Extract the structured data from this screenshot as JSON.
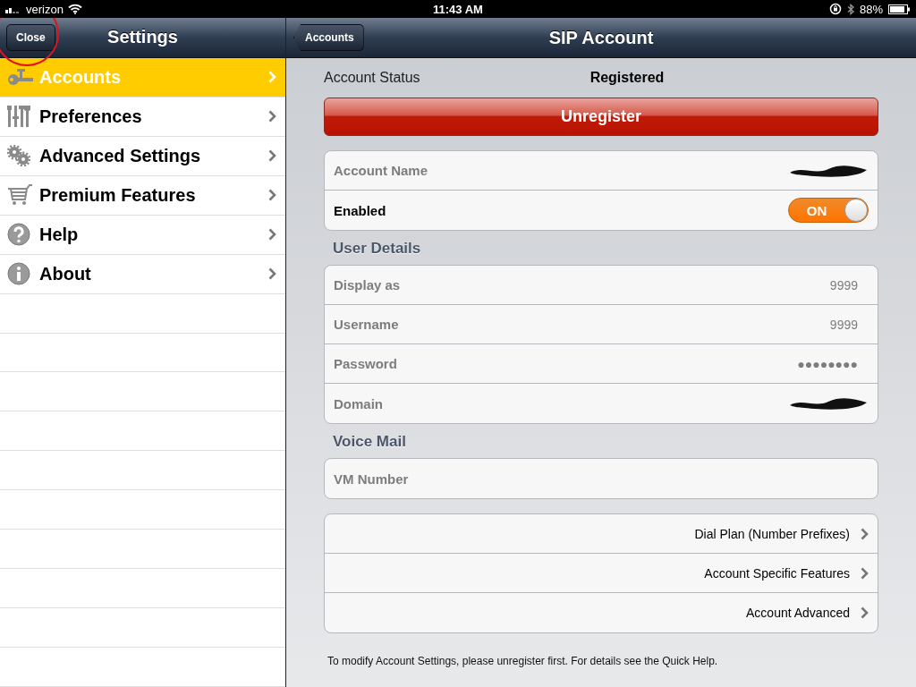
{
  "status_bar": {
    "carrier": "verizon",
    "time": "11:43 AM",
    "battery": "88%"
  },
  "sidebar": {
    "title": "Settings",
    "close_button": "Close",
    "items": [
      {
        "label": "Accounts",
        "selected": true
      },
      {
        "label": "Preferences",
        "selected": false
      },
      {
        "label": "Advanced Settings",
        "selected": false
      },
      {
        "label": "Premium Features",
        "selected": false
      },
      {
        "label": "Help",
        "selected": false
      },
      {
        "label": "About",
        "selected": false
      }
    ]
  },
  "detail": {
    "title": "SIP Account",
    "back_button": "Accounts",
    "status_label": "Account Status",
    "status_value": "Registered",
    "unregister_button": "Unregister",
    "sections": [
      {
        "rows": [
          {
            "kind": "redacted",
            "label": "Account Name"
          },
          {
            "kind": "toggle",
            "label": "Enabled",
            "on": true,
            "toggle_text": "ON"
          }
        ]
      },
      {
        "header": "User Details",
        "rows": [
          {
            "kind": "text",
            "label": "Display as",
            "value": "9999"
          },
          {
            "kind": "text",
            "label": "Username",
            "value": "9999"
          },
          {
            "kind": "text",
            "label": "Password",
            "value": "●●●●●●●●"
          },
          {
            "kind": "redacted",
            "label": "Domain"
          }
        ]
      },
      {
        "header": "Voice Mail",
        "rows": [
          {
            "kind": "text",
            "label": "VM Number"
          }
        ]
      }
    ],
    "links": [
      {
        "label": "Dial Plan (Number Prefixes)"
      },
      {
        "label": "Account Specific Features"
      },
      {
        "label": "Account Advanced"
      }
    ],
    "footer": "To modify Account Settings, please unregister first.  For details see the Quick Help."
  }
}
